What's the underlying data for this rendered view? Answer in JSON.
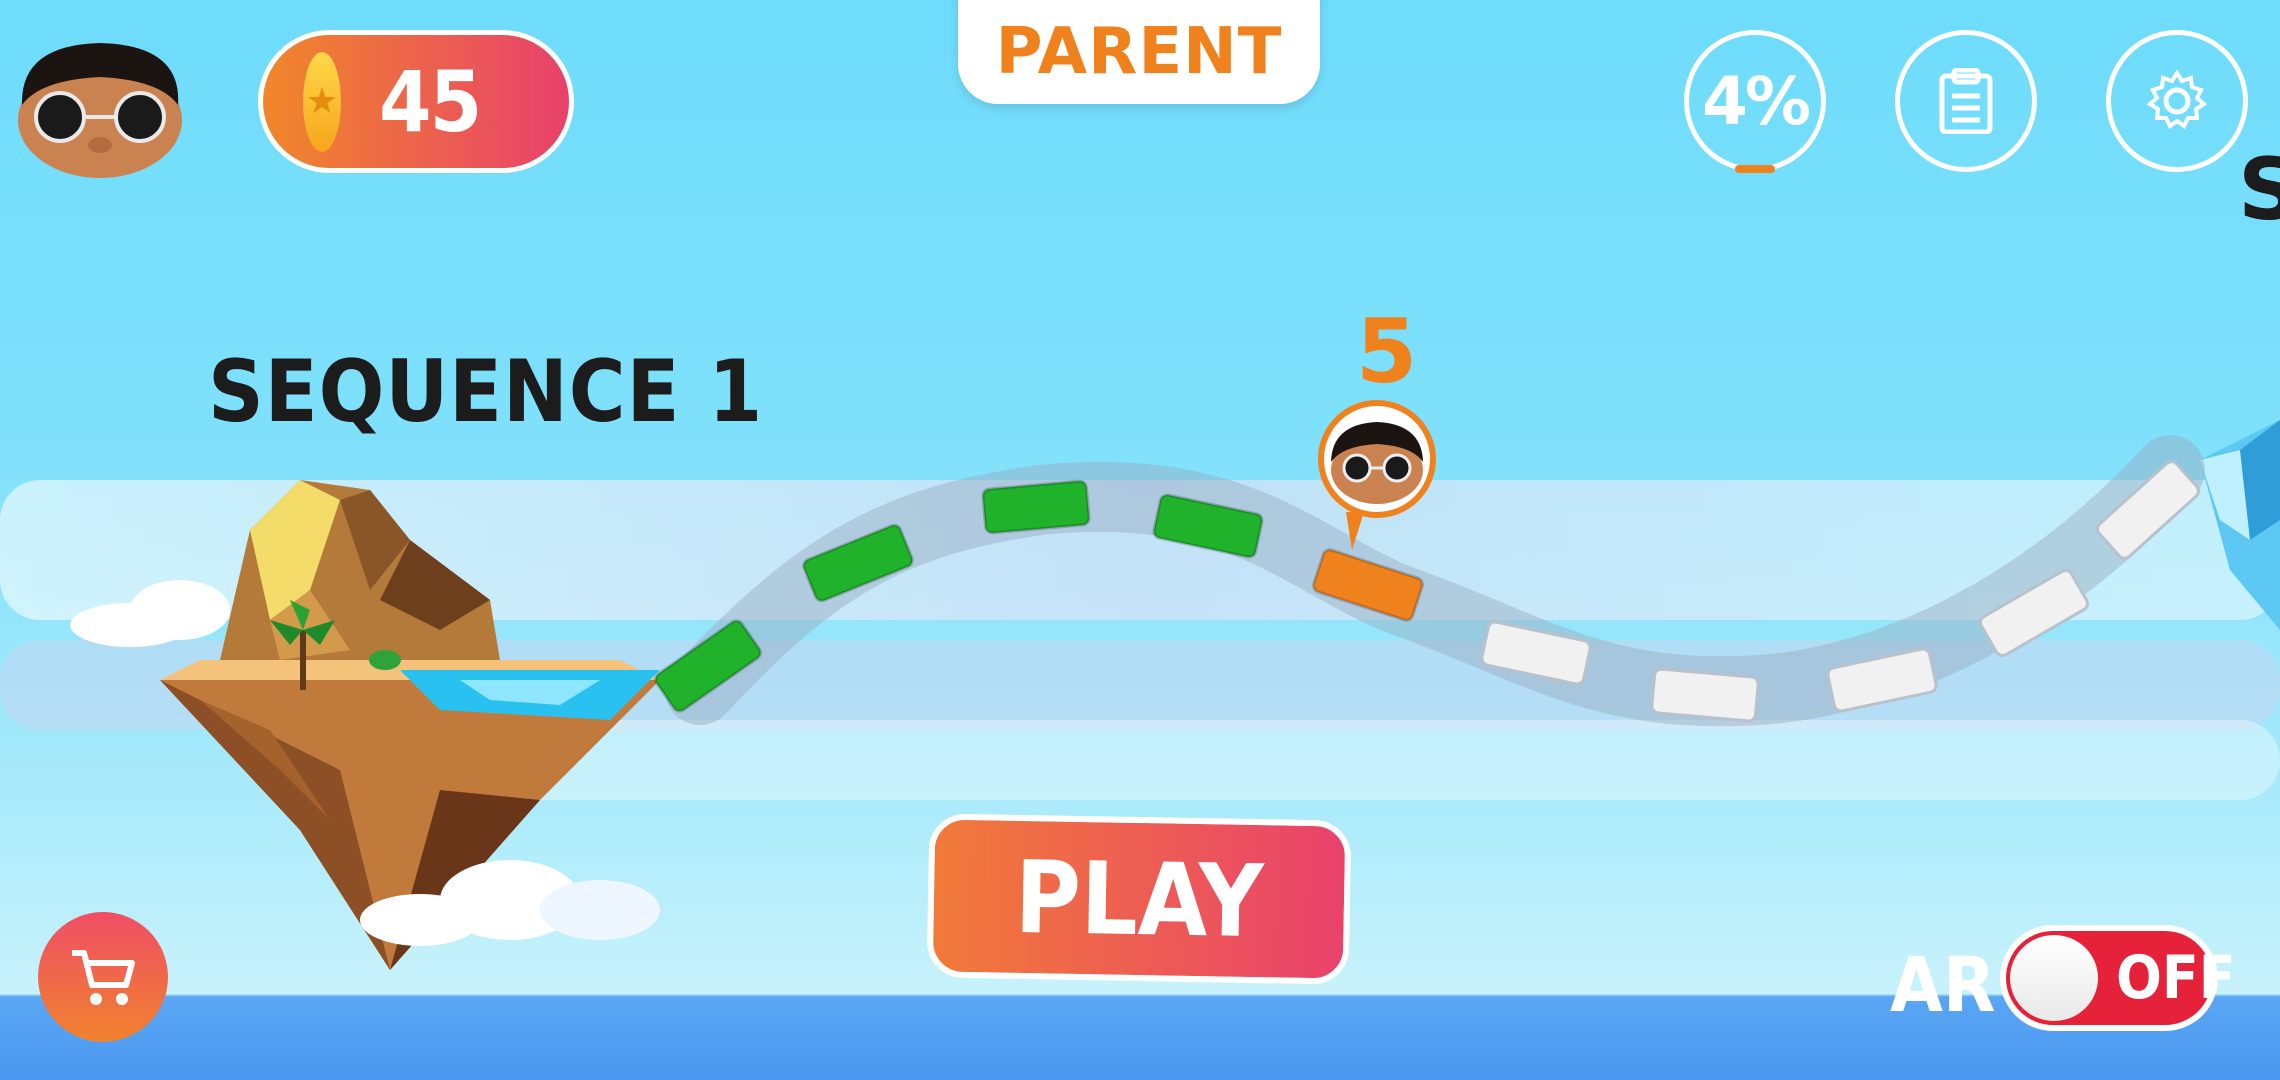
{
  "hud": {
    "coins": "45",
    "parent_label": "PARENT",
    "progress_label": "4%",
    "progress_value": 0.04,
    "clipboard_icon": "clipboard-icon",
    "settings_icon": "gear-icon"
  },
  "map": {
    "sequence_title": "SEQUENCE 1",
    "next_sequence_title": "S",
    "current_level": "5",
    "levels": [
      {
        "state": "completed"
      },
      {
        "state": "completed"
      },
      {
        "state": "completed"
      },
      {
        "state": "completed"
      },
      {
        "state": "current"
      },
      {
        "state": "locked"
      },
      {
        "state": "locked"
      },
      {
        "state": "locked"
      },
      {
        "state": "locked"
      },
      {
        "state": "locked"
      }
    ]
  },
  "actions": {
    "play_label": "PLAY",
    "cart_icon": "cart-icon"
  },
  "ar": {
    "label": "AR",
    "state": "OFF"
  },
  "colors": {
    "completed": "#1fb22a",
    "current": "#f0821e",
    "locked": "#f1f1f1",
    "accent_orange": "#f0821e",
    "accent_pink": "#e8416c"
  }
}
